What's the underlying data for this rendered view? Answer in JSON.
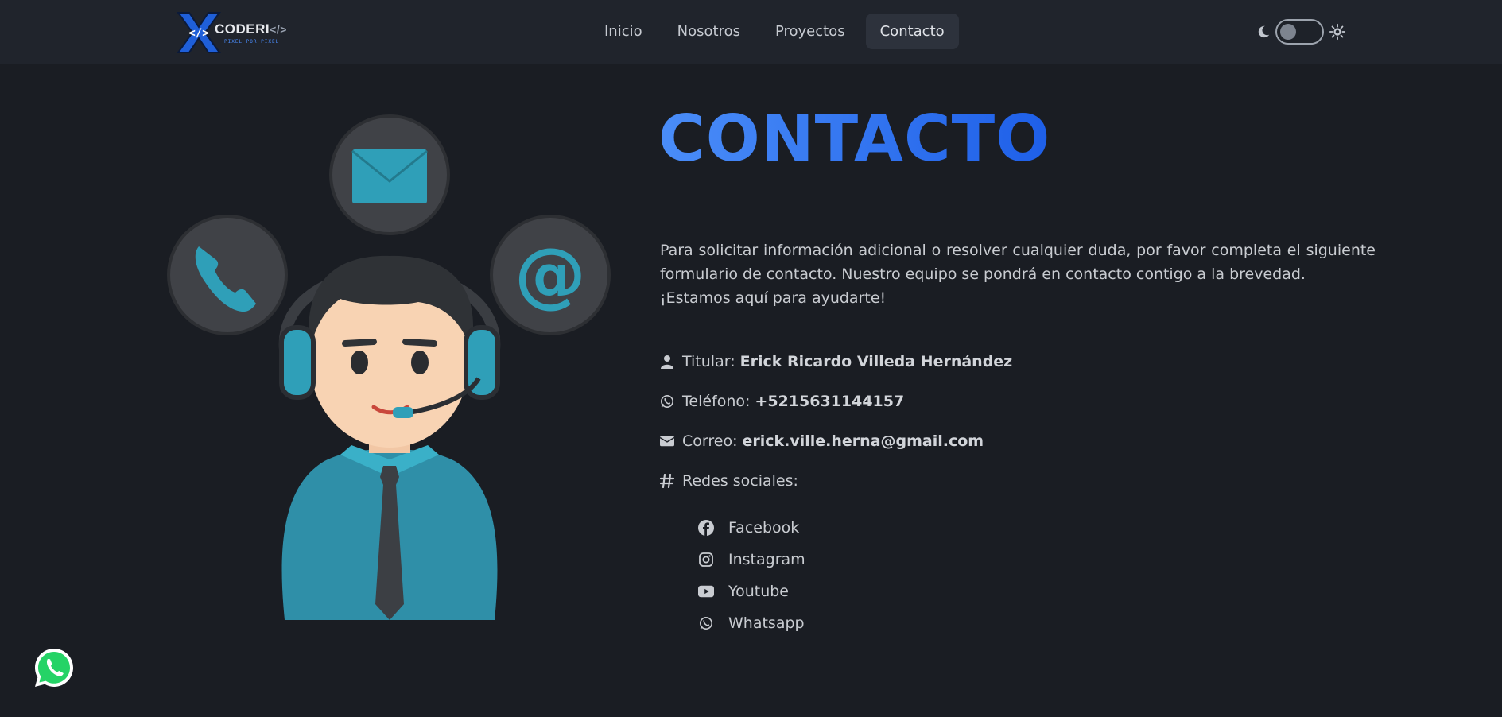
{
  "logo": {
    "name": "CODERI",
    "tag": "</>",
    "tagline": "PIXEL POR PIXEL"
  },
  "nav": {
    "items": [
      "Inicio",
      "Nosotros",
      "Proyectos",
      "Contacto"
    ],
    "active": "Contacto"
  },
  "theme": {
    "mode": "dark"
  },
  "page": {
    "title": "CONTACTO",
    "intro_1": "Para solicitar información adicional o resolver cualquier duda, por favor completa el siguiente formulario de contacto. Nuestro equipo se pondrá en contacto contigo a la brevedad.",
    "intro_2": "¡Estamos aquí para ayudarte!"
  },
  "info": {
    "owner_label": "Titular:",
    "owner_value": "Erick Ricardo Villeda Hernández",
    "phone_label": "Teléfono:",
    "phone_value": "+5215631144157",
    "email_label": "Correo:",
    "email_value": "erick.ville.herna@gmail.com",
    "social_label": "Redes sociales:"
  },
  "social": [
    "Facebook",
    "Instagram",
    "Youtube",
    "Whatsapp"
  ],
  "colors": {
    "accent": "#2f6ff0",
    "bg": "#1a1d23",
    "teal": "#2f9fb8",
    "whatsapp": "#25d366"
  }
}
